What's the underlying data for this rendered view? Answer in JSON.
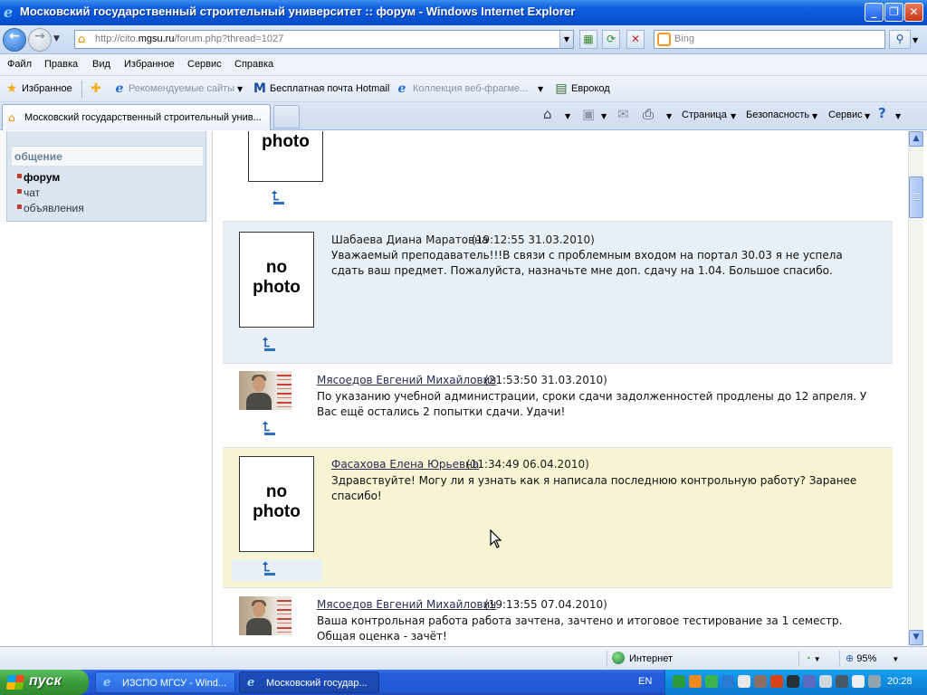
{
  "window": {
    "title": "Московский государственный строительный университет :: форум - Windows Internet Explorer",
    "buttons": {
      "minimize": "_",
      "maximize": "❐",
      "close": "✕"
    }
  },
  "navigation": {
    "back_label": "←",
    "forward_label": "→",
    "address_prefix": "http://cito.",
    "address_domain": "mgsu.ru",
    "address_suffix": "/forum.php?thread=1027",
    "search_placeholder": "Bing"
  },
  "menu": [
    "Файл",
    "Правка",
    "Вид",
    "Избранное",
    "Сервис",
    "Справка"
  ],
  "favorites_bar": {
    "favorites_label": "Избранное",
    "items": [
      {
        "label": "Рекомендуемые сайты",
        "style": "grey",
        "icon": "ie-icon"
      },
      {
        "label": "Бесплатная почта Hotmail",
        "style": "normal",
        "icon": "msn-icon"
      },
      {
        "label": "Коллекция веб-фрагме...",
        "style": "grey",
        "icon": "ie-icon"
      },
      {
        "label": "Еврокод",
        "style": "normal",
        "icon": "page-icon"
      }
    ]
  },
  "tabs": {
    "active_tab_label": "Московский государственный строительный унив...",
    "commands": [
      "Страница",
      "Безопасность",
      "Сервис"
    ]
  },
  "sidebar": {
    "section_title": "общение",
    "links": [
      {
        "label": "форум",
        "active": true
      },
      {
        "label": "чат",
        "active": false
      },
      {
        "label": "объявления",
        "active": false
      }
    ]
  },
  "posts": [
    {
      "author": "",
      "date": "",
      "message": "",
      "photo_text": "photo",
      "photo": "nophoto",
      "bg": "white"
    },
    {
      "author": "Шабаева Диана Маратовна",
      "date": "(19:12:55 31.03.2010)",
      "message": "Уважаемый преподаватель!!!В связи с проблемным входом на портал 30.03 я не успела сдать ваш предмет. Пожалуйста, назначьте мне доп. сдачу на 1.04. Большое спасибо.",
      "photo_text_1": "no",
      "photo_text_2": "photo",
      "photo": "nophoto",
      "bg": "blue"
    },
    {
      "author": "Мясоедов Евгений Михайлович",
      "date": "(21:53:50 31.03.2010)",
      "message": "По указанию учебной администрации, сроки сдачи задолженностей продлены до 12 апреля. У Вас ещё остались 2 попытки сдачи. Удачи!",
      "photo": "avatar",
      "bg": "white"
    },
    {
      "author": "Фасахова Елена Юрьевна",
      "date": "(11:34:49 06.04.2010)",
      "message": "Здравствуйте! Могу ли я узнать как я написала последнюю контрольную работу? Заранее спасибо!",
      "photo_text_1": "no",
      "photo_text_2": "photo",
      "photo": "nophoto",
      "bg": "yellow"
    },
    {
      "author": "Мясоедов Евгений Михайлович",
      "date": "(19:13:55 07.04.2010)",
      "message_line1": "Ваша контрольная работа работа зачтена, зачтено и итоговое тестирование за 1 семестр.",
      "message_line2": "Общая оценка - зачёт!",
      "photo": "avatar",
      "bg": "white"
    }
  ],
  "statusbar": {
    "zone": "Интернет",
    "zoom": "95%"
  },
  "taskbar": {
    "start_label": "пуск",
    "tasks": [
      {
        "label": "ИЗСПО МГСУ - Wind...",
        "active": false
      },
      {
        "label": "Московский государ...",
        "active": true
      }
    ],
    "language": "EN",
    "clock": "20:28"
  },
  "colors": {
    "title_bar": "#0854d6",
    "post_blue": "#e8f0f6",
    "post_yellow": "#f6f4d2",
    "taskbar": "#245edb",
    "start_button": "#3a9b3a",
    "tray": "#0f8bdf"
  }
}
